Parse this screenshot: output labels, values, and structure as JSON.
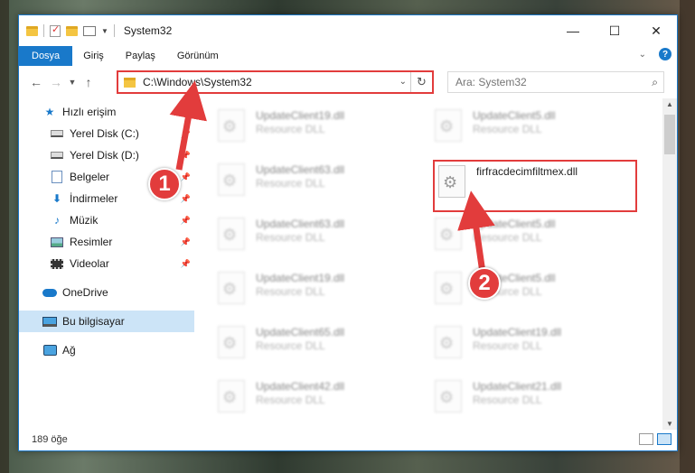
{
  "window": {
    "title": "System32"
  },
  "ribbon": {
    "tabs": [
      "Dosya",
      "Giriş",
      "Paylaş",
      "Görünüm"
    ]
  },
  "nav": {
    "address": "C:\\Windows\\System32",
    "search_placeholder": "Ara: System32"
  },
  "sidebar": {
    "items": [
      {
        "label": "Hızlı erişim",
        "icon": "star-icon"
      },
      {
        "label": "Yerel Disk (C:)",
        "icon": "drive-icon"
      },
      {
        "label": "Yerel Disk (D:)",
        "icon": "drive-icon"
      },
      {
        "label": "Belgeler",
        "icon": "document-icon"
      },
      {
        "label": "İndirmeler",
        "icon": "download-icon"
      },
      {
        "label": "Müzik",
        "icon": "music-icon"
      },
      {
        "label": "Resimler",
        "icon": "pictures-icon"
      },
      {
        "label": "Videolar",
        "icon": "video-icon"
      },
      {
        "label": "OneDrive",
        "icon": "cloud-icon"
      },
      {
        "label": "Bu bilgisayar",
        "icon": "computer-icon"
      },
      {
        "label": "Ağ",
        "icon": "network-icon"
      }
    ]
  },
  "files": [
    {
      "name": "UpdateClient19.dll",
      "type": "Resource DLL"
    },
    {
      "name": "UpdateClient5.dll",
      "type": "Resource DLL"
    },
    {
      "name": "UpdateClient63.dll",
      "type": "Resource DLL"
    },
    {
      "name": "firfracdecimfiltmex.dll",
      "type": ""
    },
    {
      "name": "UpdateClient63.dll",
      "type": "Resource DLL"
    },
    {
      "name": "UpdateClient5.dll",
      "type": "Resource DLL"
    },
    {
      "name": "UpdateClient19.dll",
      "type": "Resource DLL"
    },
    {
      "name": "UpdateClient5.dll",
      "type": "Resource DLL"
    },
    {
      "name": "UpdateClient65.dll",
      "type": "Resource DLL"
    },
    {
      "name": "UpdateClient19.dll",
      "type": "Resource DLL"
    },
    {
      "name": "UpdateClient42.dll",
      "type": "Resource DLL"
    },
    {
      "name": "UpdateClient21.dll",
      "type": "Resource DLL"
    }
  ],
  "status": {
    "count": "189 öğe"
  },
  "callouts": {
    "one": "1",
    "two": "2"
  },
  "colors": {
    "accent": "#1979ca",
    "highlight": "#e23c3c"
  }
}
